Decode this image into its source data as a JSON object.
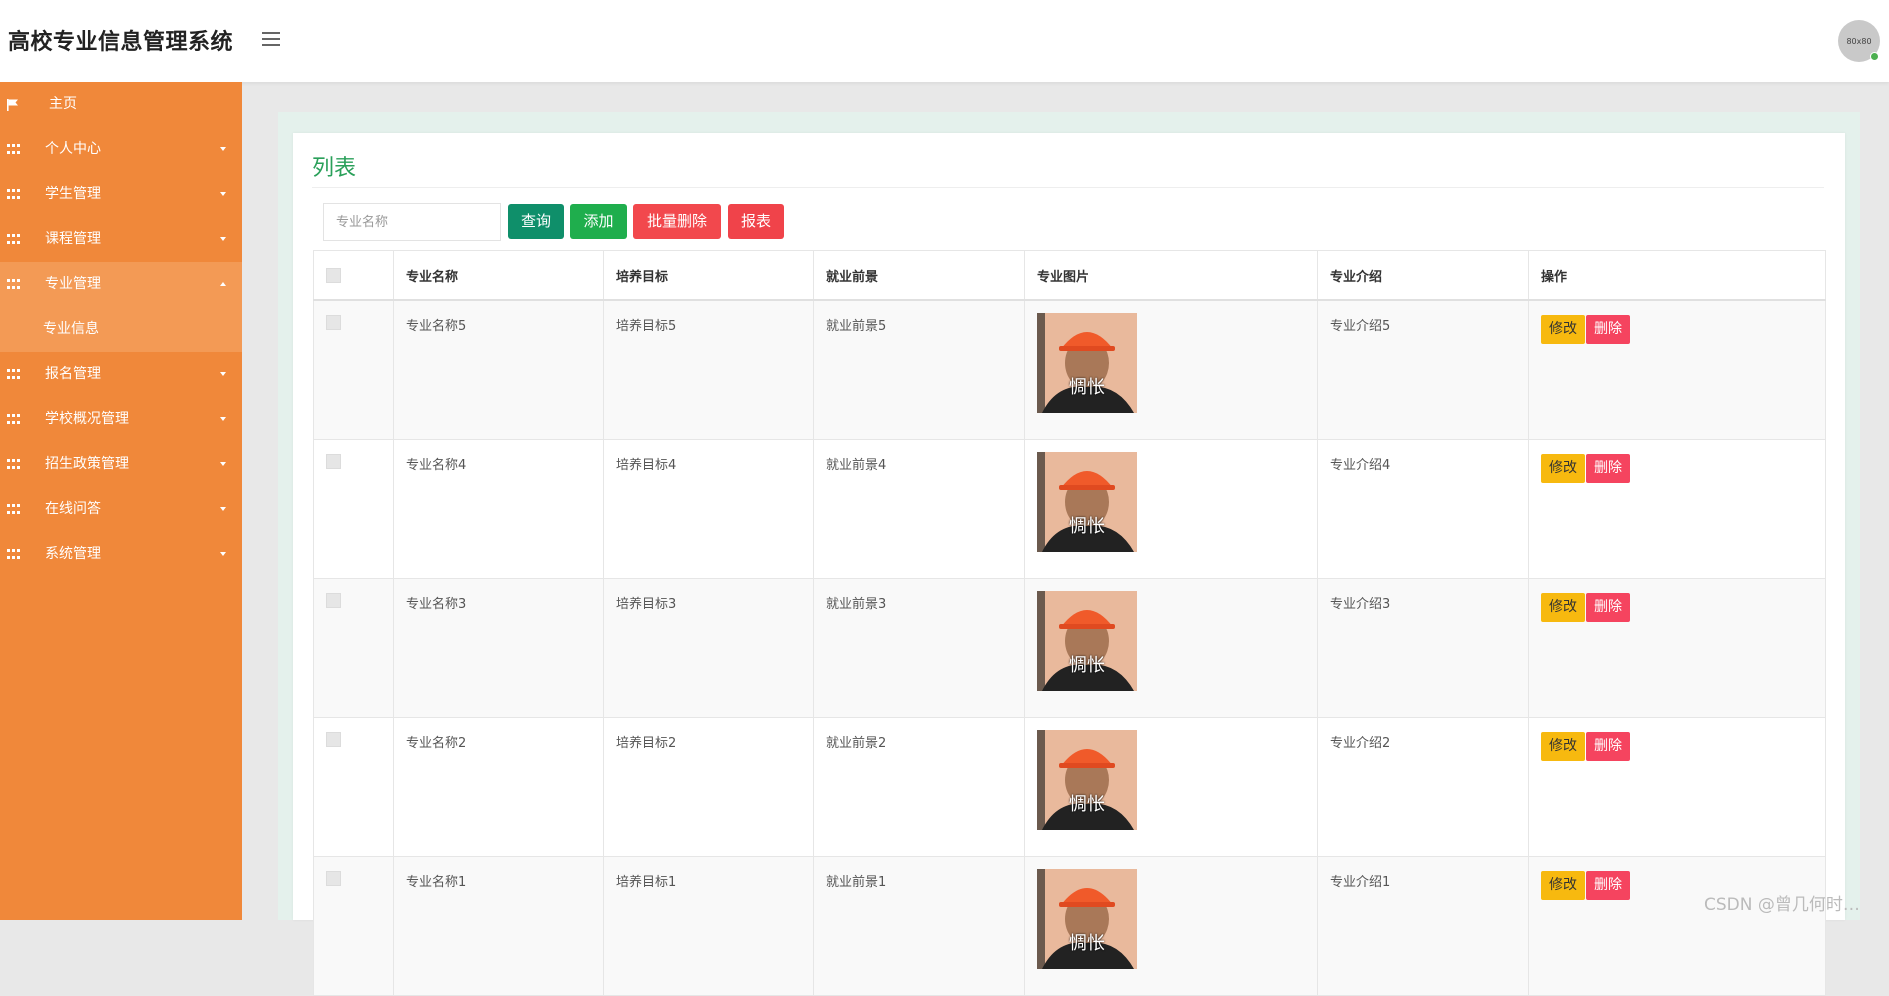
{
  "header": {
    "app_title": "高校专业信息管理系统",
    "avatar_text": "80x80"
  },
  "sidebar": {
    "items": [
      {
        "label": "主页",
        "icon": "flag-icon"
      },
      {
        "label": "个人中心",
        "icon": "grid-icon"
      },
      {
        "label": "学生管理",
        "icon": "grid-icon"
      },
      {
        "label": "课程管理",
        "icon": "grid-icon"
      },
      {
        "label": "专业管理",
        "icon": "grid-icon",
        "open": true
      },
      {
        "label": "报名管理",
        "icon": "grid-icon"
      },
      {
        "label": "学校概况管理",
        "icon": "grid-icon"
      },
      {
        "label": "招生政策管理",
        "icon": "grid-icon"
      },
      {
        "label": "在线问答",
        "icon": "grid-icon"
      },
      {
        "label": "系统管理",
        "icon": "grid-icon"
      }
    ],
    "sub_items": [
      "专业信息"
    ]
  },
  "main": {
    "title": "列表",
    "search_placeholder": "专业名称",
    "buttons": {
      "query": "查询",
      "add": "添加",
      "batch_delete": "批量删除",
      "report": "报表"
    },
    "table": {
      "headers": [
        "专业名称",
        "培养目标",
        "就业前景",
        "专业图片",
        "专业介绍",
        "操作"
      ],
      "rows": [
        {
          "name": "专业名称5",
          "goal": "培养目标5",
          "prospect": "就业前景5",
          "image_caption": "惆怅",
          "intro": "专业介绍5"
        },
        {
          "name": "专业名称4",
          "goal": "培养目标4",
          "prospect": "就业前景4",
          "image_caption": "惆怅",
          "intro": "专业介绍4"
        },
        {
          "name": "专业名称3",
          "goal": "培养目标3",
          "prospect": "就业前景3",
          "image_caption": "惆怅",
          "intro": "专业介绍3"
        },
        {
          "name": "专业名称2",
          "goal": "培养目标2",
          "prospect": "就业前景2",
          "image_caption": "惆怅",
          "intro": "专业介绍2"
        },
        {
          "name": "专业名称1",
          "goal": "培养目标1",
          "prospect": "就业前景1",
          "image_caption": "惆怅",
          "intro": "专业介绍1"
        }
      ],
      "edit_label": "修改",
      "delete_label": "删除"
    }
  },
  "watermark": "CSDN @曾几何时…",
  "colors": {
    "sidebar": "#f0883a",
    "sidebar_active": "#f39a55",
    "title_green": "#2aa05a",
    "query_button": "#0f8f6a",
    "add_button": "#1fae4d",
    "danger_button": "#f2484d",
    "edit_button": "#f7b90f",
    "delete_button": "#f5445f"
  }
}
